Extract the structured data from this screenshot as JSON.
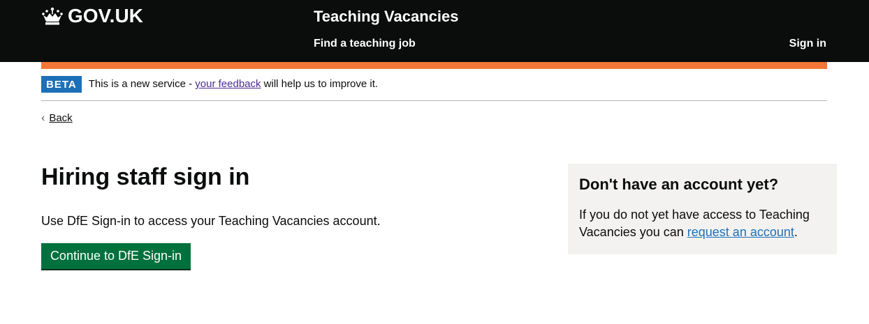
{
  "header": {
    "logo_text": "GOV.UK",
    "service_name": "Teaching Vacancies",
    "nav_find": "Find a teaching job",
    "nav_signin": "Sign in",
    "logo_icon": "crown-icon"
  },
  "colors": {
    "header_bg": "#0b0c0c",
    "accent_bar": "#f47738",
    "beta_tag": "#1d70b8",
    "button": "#00703c",
    "link": "#1d70b8",
    "visited_link": "#4c2c92",
    "aside_bg": "#f3f2f1"
  },
  "beta": {
    "tag": "BETA",
    "text_before": "This is a new service - ",
    "link": "your feedback",
    "text_after": " will help us to improve it."
  },
  "back": {
    "label": "Back",
    "icon": "chevron-left-icon"
  },
  "main": {
    "title": "Hiring staff sign in",
    "intro": "Use DfE Sign-in to access your Teaching Vacancies account.",
    "button": "Continue to DfE Sign-in"
  },
  "aside": {
    "heading": "Don't have an account yet?",
    "text_before": "If you do not yet have access to Teaching Vacancies you can ",
    "link": "request an account",
    "text_after": "."
  }
}
